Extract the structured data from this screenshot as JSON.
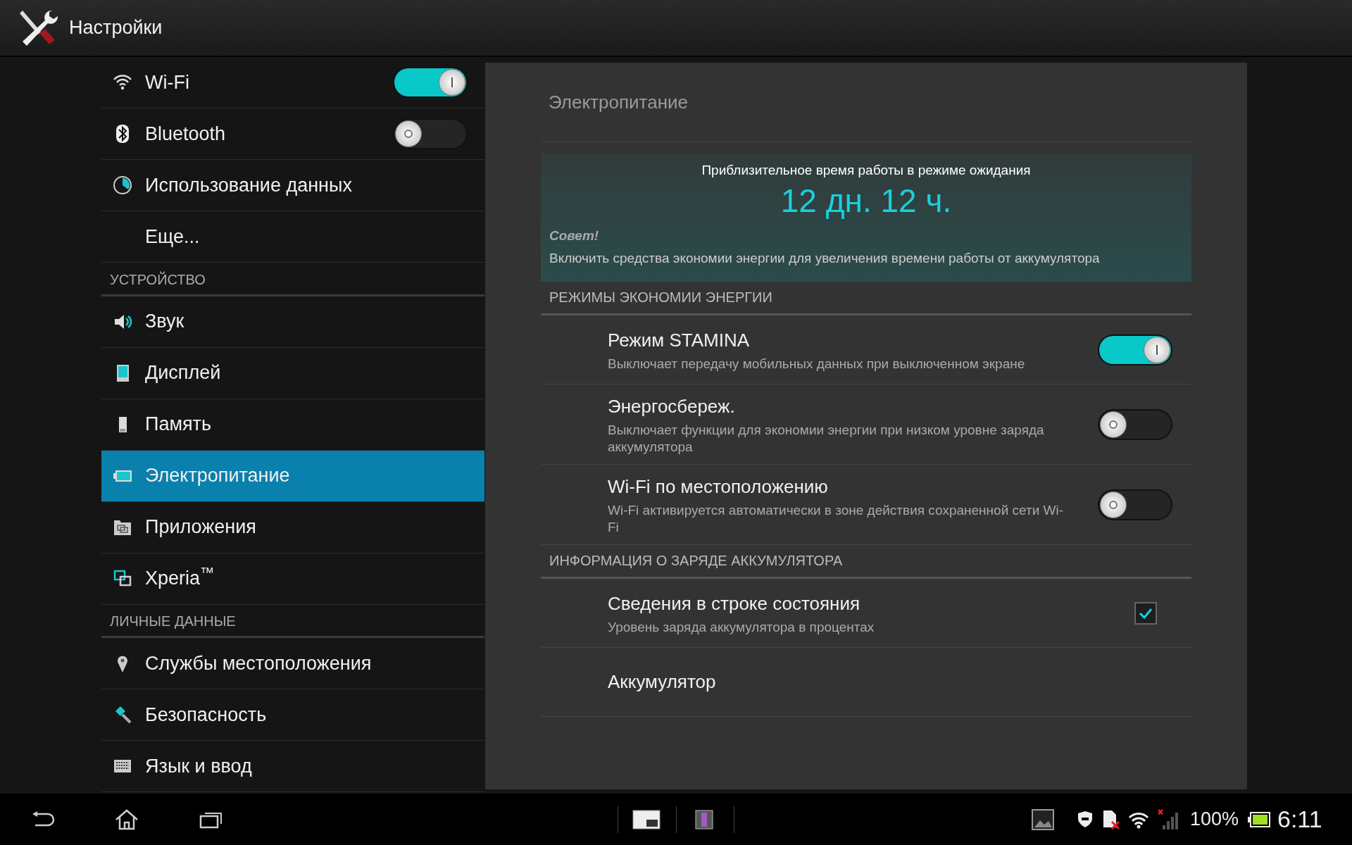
{
  "app_bar": {
    "title": "Настройки"
  },
  "sidebar": [
    {
      "items": [
        {
          "kind": "switch",
          "label": "Wi-Fi",
          "on": true,
          "selected": false
        },
        {
          "kind": "switch",
          "label": "Bluetooth",
          "on": false,
          "selected": false
        },
        {
          "kind": "link",
          "label": "Использование данных",
          "selected": false
        },
        {
          "kind": "link",
          "label": "Еще...",
          "selected": false
        }
      ]
    },
    {
      "header": "УСТРОЙСТВО",
      "items": [
        {
          "kind": "link",
          "label": "Звук",
          "selected": false
        },
        {
          "kind": "link",
          "label": "Дисплей",
          "selected": false
        },
        {
          "kind": "link",
          "label": "Память",
          "selected": false
        },
        {
          "kind": "link",
          "label": "Электропитание",
          "selected": true
        },
        {
          "kind": "link",
          "label": "Приложения",
          "selected": false
        },
        {
          "kind": "link",
          "label": "Xperia$^{™}$",
          "selected": false
        }
      ]
    },
    {
      "header": "ЛИЧНЫЕ ДАННЫЕ",
      "items": [
        {
          "kind": "link",
          "label": "Службы местоположения",
          "selected": false
        },
        {
          "kind": "link",
          "label": "Безопасность",
          "selected": false
        },
        {
          "kind": "link",
          "label": "Язык и ввод",
          "selected": false
        }
      ]
    }
  ],
  "panel": {
    "title": "Электропитание",
    "estimate": {
      "caption": "Приблизительное время работы в режиме ожидания",
      "value": "12 дн. 12 ч.",
      "tip_title": "Совет!",
      "tip_text": "Включить средства экономии энергии для увеличения времени работы от аккумулятора"
    },
    "sections": [
      {
        "header": "РЕЖИМЫ ЭКОНОМИИ ЭНЕРГИИ",
        "rows": [
          {
            "kind": "switch",
            "title": "Режим STAMINA",
            "subtitle": "Выключает передачу мобильных данных при выключенном экране",
            "on": true
          },
          {
            "kind": "switch",
            "title": "Энергосбереж.",
            "subtitle": "Выключает функции для экономии энергии при низком уровне заряда аккумулятора",
            "on": false
          },
          {
            "kind": "switch",
            "title": "Wi-Fi по местоположению",
            "subtitle": "Wi-Fi активируется автоматически в зоне действия сохраненной сети Wi-Fi",
            "on": false
          }
        ]
      },
      {
        "header": "ИНФОРМАЦИЯ О ЗАРЯДЕ АККУМУЛЯТОРА",
        "rows": [
          {
            "kind": "checkbox",
            "title": "Сведения в строке состояния",
            "subtitle": "Уровень заряда аккумулятора в процентах",
            "checked": true
          },
          {
            "kind": "link",
            "title": "Аккумулятор"
          }
        ]
      }
    ]
  },
  "system_bar": {
    "battery": "100%",
    "time": "6:11"
  }
}
